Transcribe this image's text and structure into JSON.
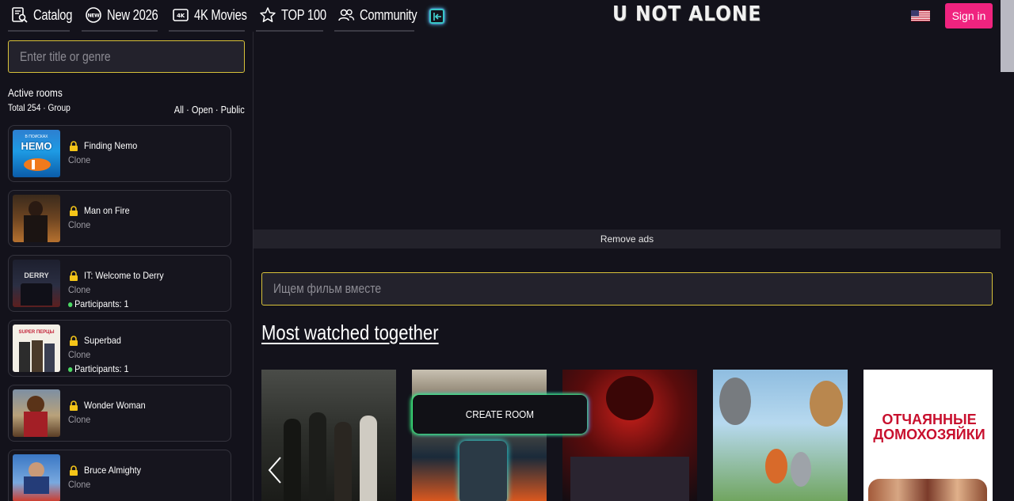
{
  "nav": {
    "items": [
      {
        "label": "Catalog",
        "icon": "catalog-search-icon"
      },
      {
        "label": "New 2026",
        "icon": "new-badge-icon"
      },
      {
        "label": "4K Movies",
        "icon": "4k-icon"
      },
      {
        "label": "TOP 100",
        "icon": "star-icon"
      },
      {
        "label": "Community",
        "icon": "users-icon"
      }
    ],
    "logo": "U NOT ALONE",
    "signin_label": "Sign in"
  },
  "sidebar": {
    "search_placeholder": "Enter title or genre",
    "rooms_title": "Active rooms",
    "rooms_sub": "Total 254 · Group",
    "filter": "All · Open · Public",
    "rooms": [
      {
        "name": "Finding Nemo",
        "sub": "Clone",
        "participants": ""
      },
      {
        "name": "Man on Fire",
        "sub": "Clone",
        "participants": ""
      },
      {
        "name": "IT: Welcome to Derry",
        "sub": "Clone",
        "participants": "Participants: 1"
      },
      {
        "name": "Superbad",
        "sub": "Clone",
        "participants": "Participants: 1"
      },
      {
        "name": "Wonder Woman",
        "sub": "Clone",
        "participants": ""
      },
      {
        "name": "Bruce Almighty",
        "sub": "Clone",
        "participants": ""
      }
    ],
    "thumb_text": {
      "nemo": "НЕМО",
      "nemo_top": "В ПОИСКАХ",
      "derry": "DERRY",
      "superbad": "SUPER ПЕРЦЫ"
    }
  },
  "main": {
    "remove_ads": "Remove ads",
    "search_placeholder": "Ищем фильм вместе",
    "section_title": "Most watched together",
    "create_room": "CREATE ROOM",
    "poster5_title": "ОТЧАЯННЫЕ ДОМОХОЗЯЙКИ"
  },
  "colors": {
    "background": "#13121b",
    "accent_pink": "#f0237f",
    "search_border": "#d8c23a",
    "lock": "#f5c518",
    "participants_dot": "#4cd964"
  }
}
